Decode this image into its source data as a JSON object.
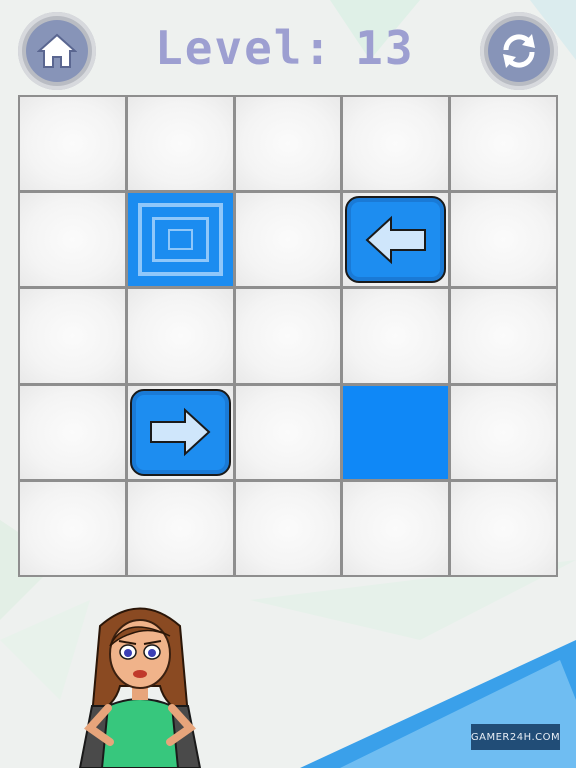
{
  "header": {
    "level_label": "Level:",
    "level_number": "13"
  },
  "icons": {
    "home": "home-icon",
    "restart": "restart-icon",
    "arrow_left": "arrow-left-icon",
    "arrow_right": "arrow-right-icon"
  },
  "board": {
    "rows": 5,
    "cols": 5,
    "cells": [
      [
        "empty",
        "empty",
        "empty",
        "empty",
        "empty"
      ],
      [
        "empty",
        "target",
        "empty",
        "arrow-left",
        "empty"
      ],
      [
        "empty",
        "empty",
        "empty",
        "empty",
        "empty"
      ],
      [
        "empty",
        "arrow-right",
        "empty",
        "filled",
        "empty"
      ],
      [
        "empty",
        "empty",
        "empty",
        "empty",
        "empty"
      ]
    ]
  },
  "colors": {
    "tile_blue": "#1b8cf0",
    "title_color": "#9d9fd1",
    "button_gray": "#8794b8"
  },
  "watermark": {
    "text": "GAMER24H.COM"
  }
}
